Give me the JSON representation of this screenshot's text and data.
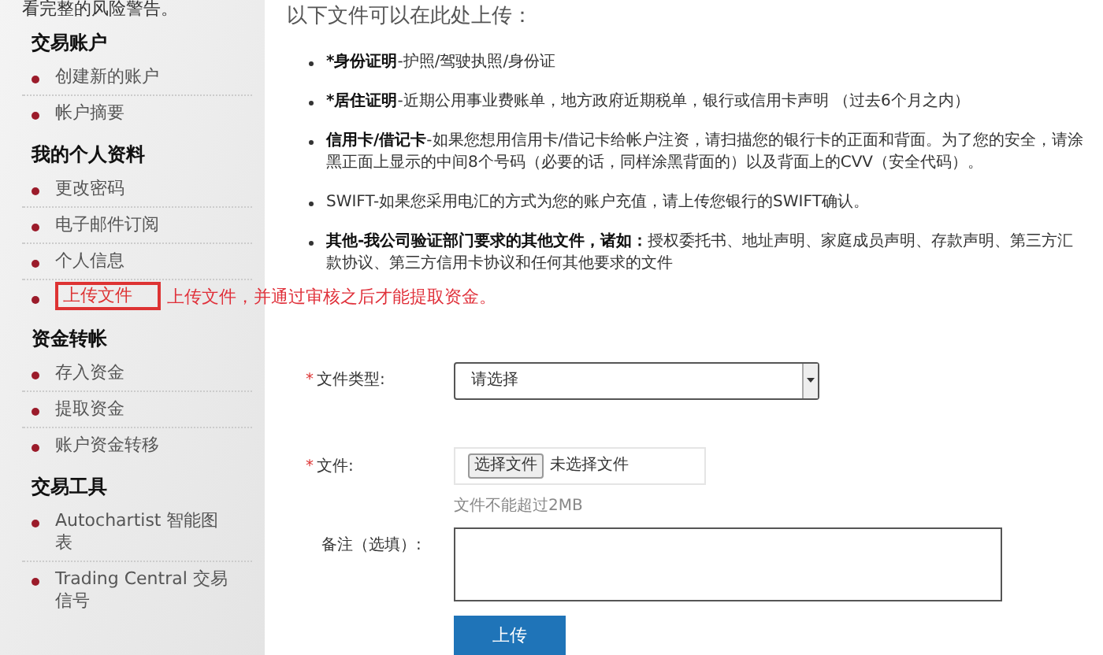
{
  "sidebar": {
    "top_text": "看完整的风险警告。",
    "sections": [
      {
        "heading": "交易账户",
        "items": [
          {
            "label": "创建新的账户",
            "highlighted": false
          },
          {
            "label": "帐户摘要",
            "highlighted": false
          }
        ]
      },
      {
        "heading": "我的个人资料",
        "items": [
          {
            "label": "更改密码",
            "highlighted": false
          },
          {
            "label": "电子邮件订阅",
            "highlighted": false
          },
          {
            "label": "个人信息",
            "highlighted": false
          },
          {
            "label": "上传文件",
            "highlighted": true,
            "annotation": "上传文件，并通过审核之后才能提取资金。"
          }
        ]
      },
      {
        "heading": "资金转帐",
        "items": [
          {
            "label": "存入资金",
            "highlighted": false
          },
          {
            "label": "提取资金",
            "highlighted": false
          },
          {
            "label": "账户资金转移",
            "highlighted": false
          }
        ]
      },
      {
        "heading": "交易工具",
        "items": [
          {
            "label": "Autochartist 智能图表",
            "highlighted": false
          },
          {
            "label": "Trading Central 交易信号",
            "highlighted": false
          }
        ]
      }
    ]
  },
  "main": {
    "title": "以下文件可以在此处上传：",
    "documents": [
      {
        "term": "*身份证明",
        "term_bold": true,
        "description": "-护照/驾驶执照/身份证"
      },
      {
        "term": "*居住证明",
        "term_bold": true,
        "description": "-近期公用事业费账单，地方政府近期税单，银行或信用卡声明 （过去6个月之内）"
      },
      {
        "term": "信用卡/借记卡",
        "term_bold": true,
        "description": "-如果您想用信用卡/借记卡给帐户注资，请扫描您的银行卡的正面和背面。为了您的安全，请涂黑正面上显示的中间8个号码（必要的话，同样涂黑背面的）以及背面上的CVV（安全代码）。"
      },
      {
        "term": "SWIFT",
        "term_bold": false,
        "description": "-如果您采用电汇的方式为您的账户充值，请上传您银行的SWIFT确认。"
      },
      {
        "term": "其他-我公司验证部门要求的其他文件，诸如：",
        "term_bold": true,
        "description": "授权委托书、地址声明、家庭成员声明、存款声明、第三方汇款协议、第三方信用卡协议和任何其他要求的文件"
      }
    ],
    "form": {
      "file_type": {
        "label": "文件类型:",
        "required_mark": "*",
        "value": "请选择"
      },
      "file": {
        "label": "文件:",
        "required_mark": "*",
        "button": "选择文件",
        "status": "未选择文件",
        "hint": "文件不能超过2MB"
      },
      "note": {
        "label": "备注（选填）:"
      },
      "submit": "上传"
    }
  }
}
